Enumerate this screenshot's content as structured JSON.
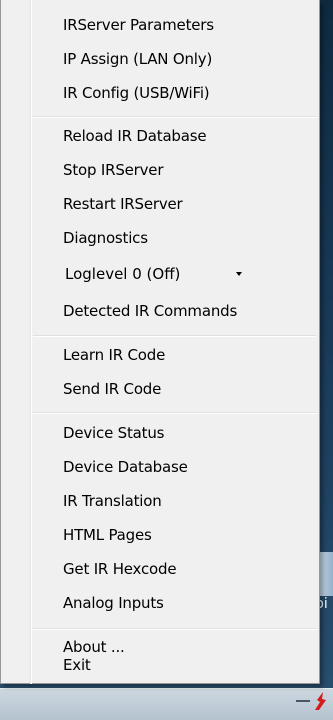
{
  "menu": {
    "group1": [
      "IRServer Parameters",
      "IP Assign (LAN Only)",
      "IR Config (USB/WiFi)"
    ],
    "group2": [
      "Reload IR Database",
      "Stop IRServer",
      "Restart IRServer",
      "Diagnostics"
    ],
    "loglevel": {
      "selected": "Loglevel 0 (Off)"
    },
    "detected": "Detected IR Commands",
    "group3": [
      "Learn IR Code",
      "Send IR Code"
    ],
    "group4": [
      "Device Status",
      "Device Database",
      "IR Translation",
      "HTML Pages",
      "Get IR Hexcode",
      "Analog Inputs"
    ],
    "group5": [
      "About ...",
      "Exit"
    ]
  },
  "desktop": {
    "recycle_bin_label": "pi"
  },
  "icons": {
    "dropdown": "chevron-down-icon",
    "tray": "irtrans-tray-icon",
    "recycle_bin": "recycle-bin-icon"
  },
  "colors": {
    "menu_background": "#f0f0f0",
    "menu_border": "#979797",
    "separator": "#e0e0e0",
    "taskbar": "#c3ced8"
  }
}
